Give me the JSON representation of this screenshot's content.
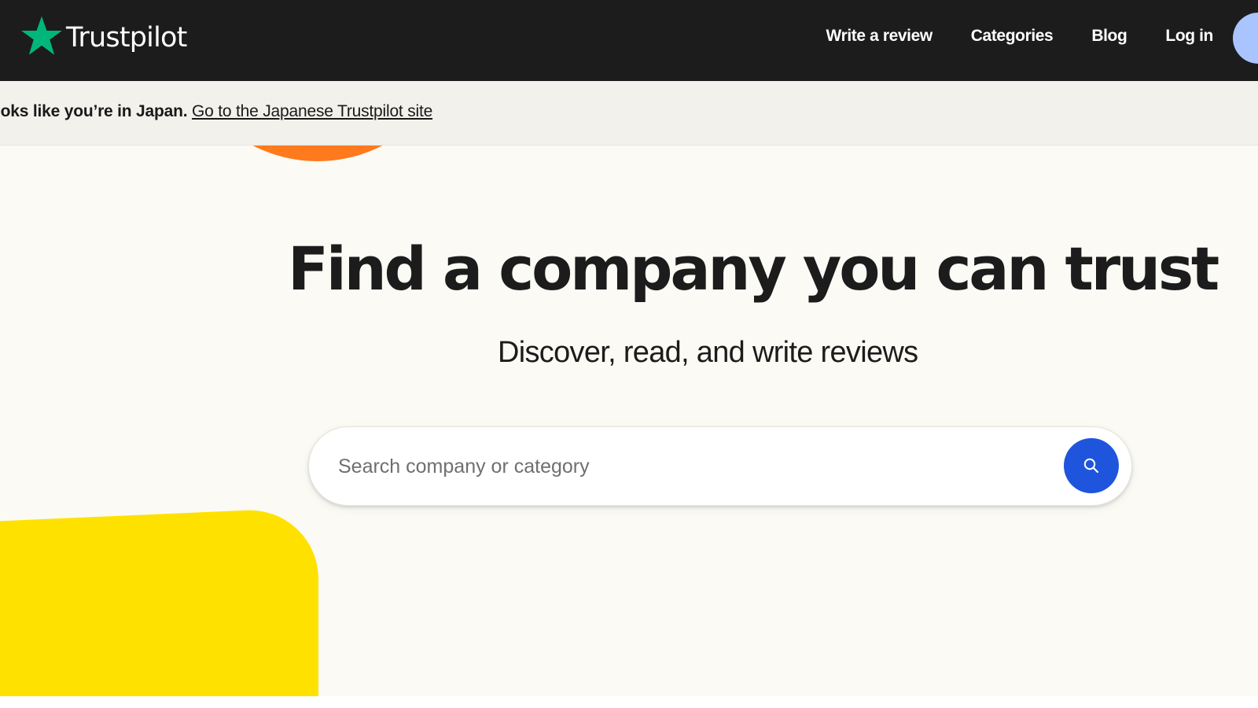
{
  "header": {
    "brand": "Trustpilot",
    "nav": {
      "write_review": "Write a review",
      "categories": "Categories",
      "blog": "Blog",
      "login": "Log in"
    },
    "star_icon": "trustpilot-star-icon",
    "avatar": "user-avatar"
  },
  "locale_notice": {
    "message": "ooks like you’re in Japan.",
    "link_text": "Go to the Japanese Trustpilot site"
  },
  "hero": {
    "title": "Find a company you can trust",
    "subtitle": "Discover, read, and write reviews",
    "search": {
      "placeholder": "Search company or category",
      "value": "",
      "icon": "search-icon"
    }
  },
  "colors": {
    "header_bg": "#1c1c1c",
    "brand_green": "#00b67a",
    "hero_bg": "#fbfaf4",
    "locale_bg": "#f2f1ec",
    "orange_shape": "#ff7a1c",
    "yellow_shape": "#ffe100",
    "search_button": "#1f55dd",
    "avatar_bg": "#a9c4ff"
  }
}
